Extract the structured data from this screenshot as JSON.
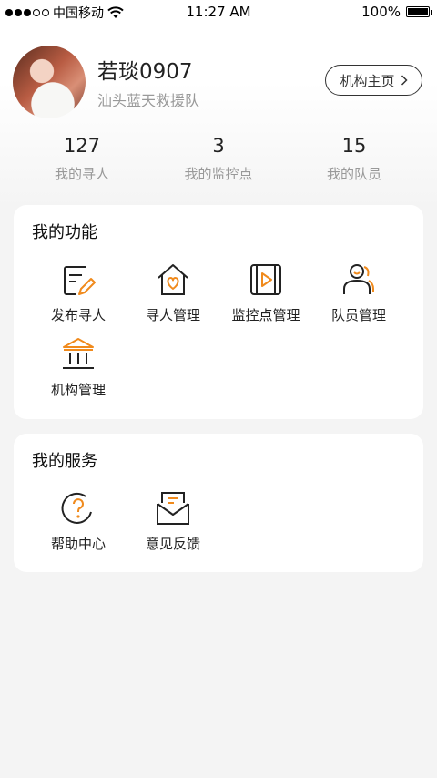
{
  "status_bar": {
    "carrier": "中国移动",
    "time": "11:27 AM",
    "battery": "100%"
  },
  "profile": {
    "name": "若琰0907",
    "org": "汕头蓝天救援队",
    "org_home_label": "机构主页"
  },
  "stats": [
    {
      "value": "127",
      "label": "我的寻人"
    },
    {
      "value": "3",
      "label": "我的监控点"
    },
    {
      "value": "15",
      "label": "我的队员"
    }
  ],
  "functions": {
    "title": "我的功能",
    "items": [
      {
        "label": "发布寻人",
        "icon": "edit-document-icon"
      },
      {
        "label": "寻人管理",
        "icon": "home-heart-icon"
      },
      {
        "label": "监控点管理",
        "icon": "video-play-icon"
      },
      {
        "label": "队员管理",
        "icon": "team-members-icon"
      },
      {
        "label": "机构管理",
        "icon": "institution-icon"
      }
    ]
  },
  "services": {
    "title": "我的服务",
    "items": [
      {
        "label": "帮助中心",
        "icon": "help-icon"
      },
      {
        "label": "意见反馈",
        "icon": "feedback-mail-icon"
      }
    ]
  },
  "colors": {
    "accent": "#f08a1c",
    "text_primary": "#222222",
    "text_secondary": "#999999",
    "background": "#f4f4f4"
  }
}
